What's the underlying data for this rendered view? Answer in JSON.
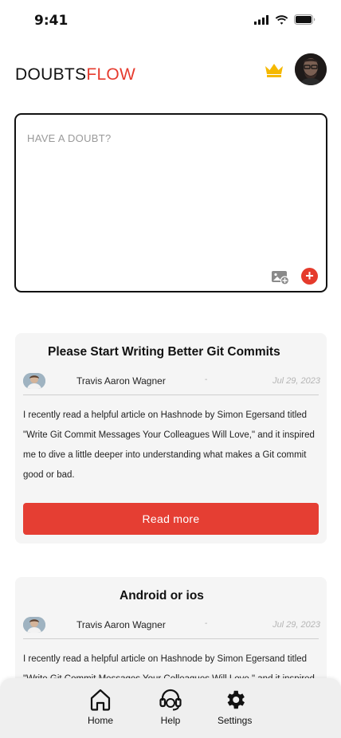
{
  "status_bar": {
    "time": "9:41"
  },
  "header": {
    "brand_part1": "DOUBTS",
    "brand_part2": "FLOW",
    "brand_accent": "#e63b2e"
  },
  "composer": {
    "placeholder": "HAVE A DOUBT?"
  },
  "posts": [
    {
      "title": "Please Start Writing Better Git Commits",
      "author": "Travis Aaron Wagner",
      "separator": "-",
      "date": "Jul 29, 2023",
      "body": "I recently read a helpful article on Hashnode by Simon Egersand titled \"Write Git Commit Messages Your Colleagues Will Love,\" and it inspired me to dive a little deeper into understanding what makes a Git commit good or bad.",
      "cta": "Read more"
    },
    {
      "title": "Android or ios",
      "author": "Travis Aaron Wagner",
      "separator": "-",
      "date": "Jul 29, 2023",
      "body": "I recently read a helpful article on Hashnode by Simon Egersand titled \"Write Git Commit Messages Your Colleagues Will Love,\" and it inspired me to dive a little deeper into understanding what makes a Git commit good or bad."
    }
  ],
  "nav": {
    "home": "Home",
    "help": "Help",
    "settings": "Settings"
  },
  "colors": {
    "accent": "#e53e33",
    "crown": "#f5b800"
  }
}
